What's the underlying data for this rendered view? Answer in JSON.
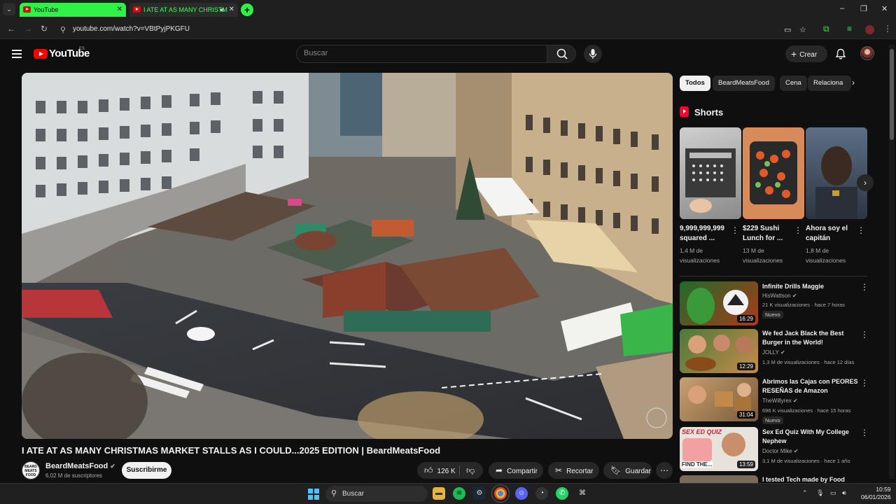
{
  "browser": {
    "tabs": [
      {
        "title": "YouTube"
      },
      {
        "title": "I ATE AT AS MANY CHRISTM"
      }
    ],
    "url": "youtube.com/watch?v=VBtPyjPKGFU"
  },
  "header": {
    "logo_text": "YouTube",
    "country_code": "ES",
    "search_placeholder": "Buscar",
    "create_label": "Crear"
  },
  "video": {
    "title": "I ATE AT AS MANY CHRISTMAS MARKET STALLS AS I COULD...2025 EDITION | BeardMeatsFood",
    "channel": "BeardMeatsFood",
    "subscribers": "6,02 M de suscriptores",
    "subscribe_label": "Suscribirme",
    "likes": "126 K",
    "share_label": "Compartir",
    "clip_label": "Recortar",
    "save_label": "Guardar",
    "watermark": "BEARD MEATS FOOD"
  },
  "sidebar": {
    "chips": [
      "Todos",
      "BeardMeatsFood",
      "Cena",
      "Relaciona"
    ],
    "shorts_title": "Shorts",
    "shorts": [
      {
        "title": "9,999,999,999 squared ...",
        "views": "1,4 M de visualizaciones"
      },
      {
        "title": "$229 Sushi Lunch for ...",
        "views": "13 M de visualizaciones"
      },
      {
        "title": "Ahora soy el capitán",
        "views": "1,8 M de visualizaciones"
      }
    ],
    "recommendations": [
      {
        "title": "Infinite Drills Maggie",
        "channel": "HisWattson",
        "meta": "21 K visualizaciones · hace 7 horas",
        "badge": "Nuevo",
        "duration": "16:29"
      },
      {
        "title": "We fed Jack Black the Best Burger in the World!",
        "channel": "JOLLY",
        "meta": "1,3 M de visualizaciones · hace 12 días",
        "badge": "",
        "duration": "12:29"
      },
      {
        "title": "Abrimos las Cajas con PEORES RESEÑAS de Amazon",
        "channel": "TheWillyrex",
        "meta": "696 K visualizaciones · hace 15 horas",
        "badge": "Nuevo",
        "duration": "31:04"
      },
      {
        "title": "Sex Ed Quiz With My College Nephew",
        "channel": "Doctor Mike",
        "meta": "3,1 M de visualizaciones · hace 1 año",
        "badge": "",
        "duration": "13:59",
        "thumb_text_top": "SEX ED QUIZ",
        "thumb_text_bottom": "FIND THE..."
      },
      {
        "title": "I tested Tech made by Food",
        "channel": "",
        "meta": "",
        "badge": "",
        "duration": ""
      }
    ]
  },
  "taskbar": {
    "search_placeholder": "Buscar",
    "time": "10:59",
    "date": "06/01/2026"
  }
}
